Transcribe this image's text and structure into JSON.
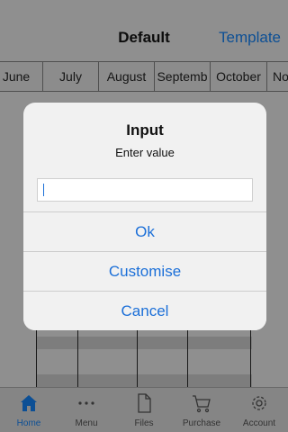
{
  "navbar": {
    "title": "Default",
    "right_button": "Template"
  },
  "months": [
    "June",
    "July",
    "August",
    "Septemb",
    "October",
    "No"
  ],
  "tabbar": {
    "items": [
      {
        "label": "Home",
        "icon": "home-icon",
        "active": true
      },
      {
        "label": "Menu",
        "icon": "ellipsis-icon"
      },
      {
        "label": "Files",
        "icon": "document-icon"
      },
      {
        "label": "Purchase",
        "icon": "cart-icon"
      },
      {
        "label": "Account",
        "icon": "gear-icon"
      }
    ]
  },
  "alert": {
    "title": "Input",
    "message": "Enter value",
    "input_value": "",
    "buttons": {
      "ok": "Ok",
      "customise": "Customise",
      "cancel": "Cancel"
    }
  },
  "colors": {
    "accent": "#1b6fd8",
    "dim_overlay": "#8f8f8f",
    "alert_bg": "#f1f1f1"
  }
}
